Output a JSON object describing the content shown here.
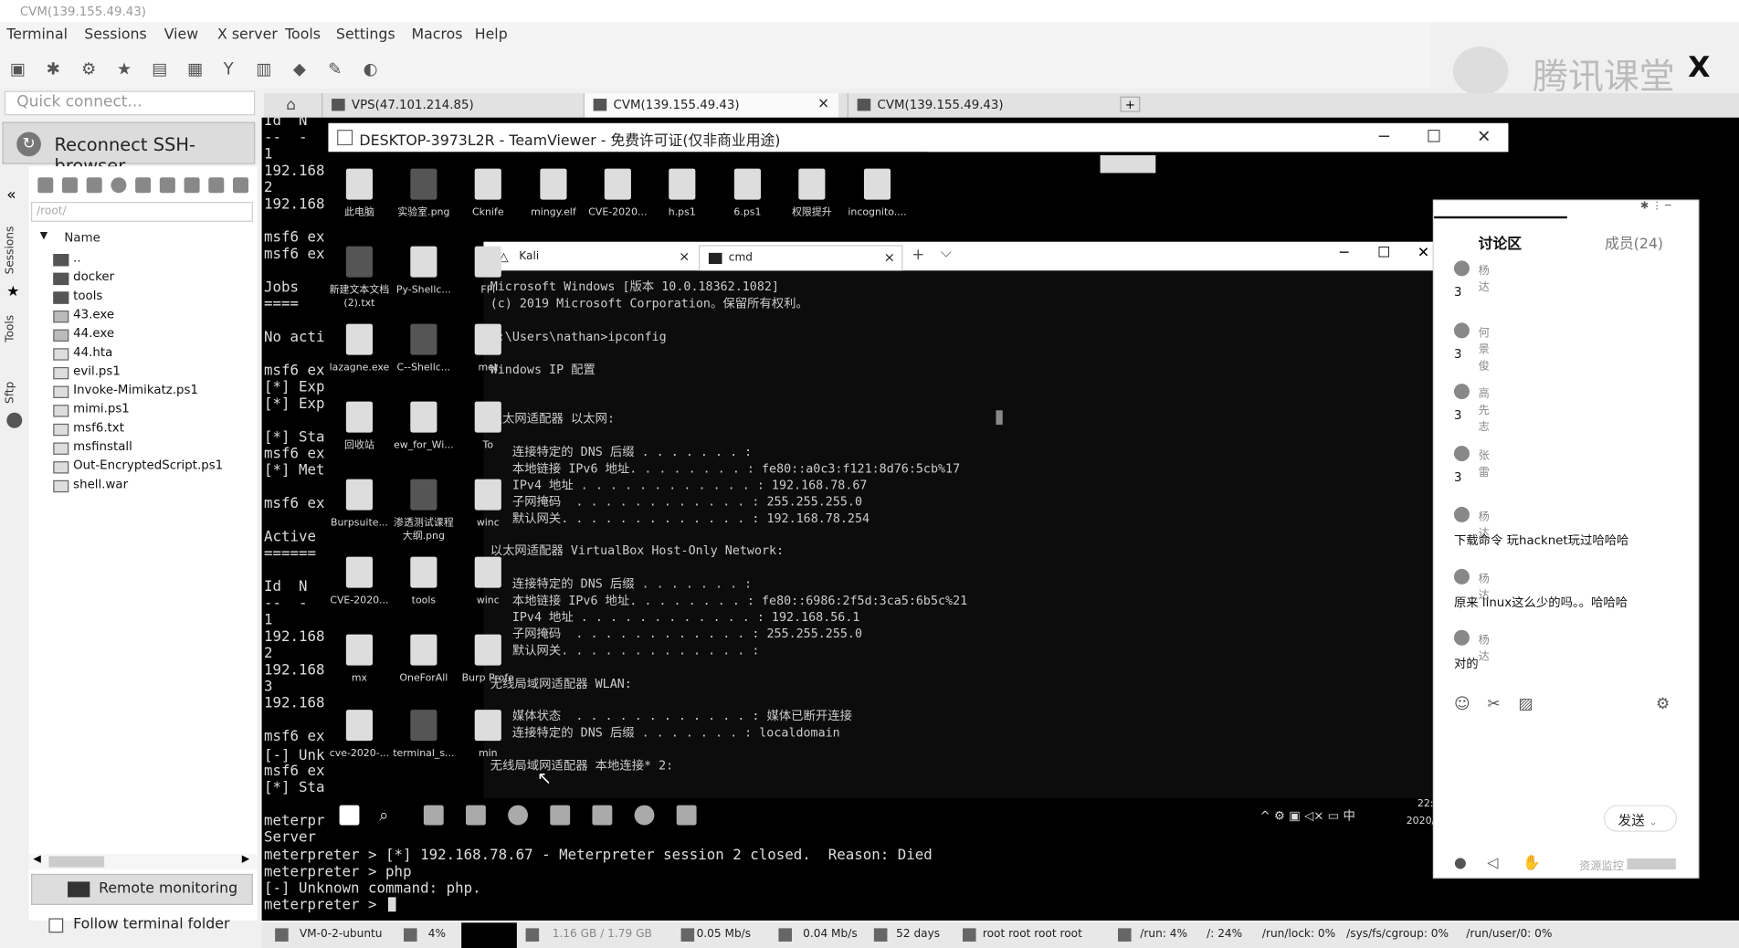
{
  "window": {
    "title": "CVM(139.155.49.43)"
  },
  "menu": [
    "Terminal",
    "Sessions",
    "View",
    "X server",
    "Tools",
    "Settings",
    "Macros",
    "Help"
  ],
  "brand": {
    "text": "腾讯课堂",
    "close": "X"
  },
  "quick_connect": {
    "placeholder": "Quick connect..."
  },
  "session_tabs": [
    {
      "label": "VPS(47.101.214.85)"
    },
    {
      "label": "CVM(139.155.49.43)",
      "close": "×"
    },
    {
      "label": "CVM(139.155.49.43)"
    }
  ],
  "sidebar": {
    "reconnect_label": "Reconnect SSH-browser",
    "vertical_tabs": [
      "Sessions",
      "Tools",
      "Sftp"
    ],
    "path": "/root/",
    "name_header": "Name",
    "files": [
      {
        "name": "..",
        "type": "folder"
      },
      {
        "name": "docker",
        "type": "folder"
      },
      {
        "name": "tools",
        "type": "folder"
      },
      {
        "name": "43.exe",
        "type": "exe"
      },
      {
        "name": "44.exe",
        "type": "exe"
      },
      {
        "name": "44.hta",
        "type": "file"
      },
      {
        "name": "evil.ps1",
        "type": "file"
      },
      {
        "name": "Invoke-Mimikatz.ps1",
        "type": "file"
      },
      {
        "name": "mimi.ps1",
        "type": "file"
      },
      {
        "name": "msf6.txt",
        "type": "file"
      },
      {
        "name": "msfinstall",
        "type": "file"
      },
      {
        "name": "Out-EncryptedScript.ps1",
        "type": "file"
      },
      {
        "name": "shell.war",
        "type": "file"
      }
    ],
    "remote_monitoring": "Remote monitoring",
    "follow_folder": "Follow terminal folder"
  },
  "terminal_lines": [
    "Id  N",
    "--  -",
    "1",
    "192.168",
    "2",
    "192.168",
    "",
    "msf6 ex",
    "msf6 ex",
    "",
    "Jobs",
    "====",
    "",
    "No acti",
    "",
    "msf6 ex",
    "[*] Exp",
    "[*] Exp",
    "",
    "[*] Sta",
    "msf6 ex",
    "[*] Met",
    "",
    "msf6 ex",
    "",
    "Active",
    "======",
    "",
    "Id  N",
    "--  -",
    "1",
    "192.168",
    "2",
    "192.168",
    "3",
    "192.168",
    "",
    "msf6 ex",
    "[-] Unk",
    "msf6 ex",
    "[*] Sta",
    "",
    "meterpr",
    "Server",
    "meterpreter > [*] 192.168.78.67 - Meterpreter session 2 closed.  Reason: Died",
    "meterpreter > php",
    "[-] Unknown command: php.",
    "meterpreter > "
  ],
  "teamviewer": {
    "title": "DESKTOP-3973L2R - TeamViewer - 免费许可证(仅非商业用途)",
    "min": "─",
    "max": "☐",
    "close": "✕"
  },
  "desktop_icons": [
    {
      "label": "此电脑"
    },
    {
      "label": "实验室.png"
    },
    {
      "label": "Cknife"
    },
    {
      "label": "mingy.elf"
    },
    {
      "label": "CVE-2020..."
    },
    {
      "label": "h.ps1"
    },
    {
      "label": "6.ps1"
    },
    {
      "label": "权限提升"
    },
    {
      "label": "incognito...."
    },
    {
      "label": "新建文本文档 (2).txt"
    },
    {
      "label": "Py-Shellc..."
    },
    {
      "label": "FPi"
    },
    {
      "label": "lazagne.exe"
    },
    {
      "label": "C--Shellc..."
    },
    {
      "label": "met"
    },
    {
      "label": "回收站"
    },
    {
      "label": "ew_for_Wi..."
    },
    {
      "label": "To"
    },
    {
      "label": "Burpsuite..."
    },
    {
      "label": "渗透测试课程大纲.png"
    },
    {
      "label": "winc"
    },
    {
      "label": "CVE-2020..."
    },
    {
      "label": "tools"
    },
    {
      "label": "winc"
    },
    {
      "label": "mx"
    },
    {
      "label": "OneForAll"
    },
    {
      "label": "Burp Profe"
    },
    {
      "label": "cve-2020-..."
    },
    {
      "label": "terminal_s..."
    },
    {
      "label": "min"
    }
  ],
  "cmd": {
    "tabs": [
      {
        "label": "Kali",
        "close": "×"
      },
      {
        "label": "cmd",
        "close": "×"
      }
    ],
    "new_tab": "+",
    "dropdown": "⌵",
    "lines": [
      "Microsoft Windows [版本 10.0.18362.1082]",
      "(c) 2019 Microsoft Corporation。保留所有权利。",
      "",
      "C:\\Users\\nathan>ipconfig",
      "",
      "Windows IP 配置",
      "",
      "",
      "以太网适配器 以太网:",
      "",
      "   连接特定的 DNS 后缀 . . . . . . . :",
      "   本地链接 IPv6 地址. . . . . . . . : fe80::a0c3:f121:8d76:5cb%17",
      "   IPv4 地址 . . . . . . . . . . . . : 192.168.78.67",
      "   子网掩码  . . . . . . . . . . . . : 255.255.255.0",
      "   默认网关. . . . . . . . . . . . . : 192.168.78.254",
      "",
      "以太网适配器 VirtualBox Host-Only Network:",
      "",
      "   连接特定的 DNS 后缀 . . . . . . . :",
      "   本地链接 IPv6 地址. . . . . . . . : fe80::6986:2f5d:3ca5:6b5c%21",
      "   IPv4 地址 . . . . . . . . . . . . : 192.168.56.1",
      "   子网掩码  . . . . . . . . . . . . : 255.255.255.0",
      "   默认网关. . . . . . . . . . . . . :",
      "",
      "无线局域网适配器 WLAN:",
      "",
      "   媒体状态  . . . . . . . . . . . . : 媒体已断开连接",
      "   连接特定的 DNS 后缀 . . . . . . . : localdomain",
      "",
      "无线局域网适配器 本地连接* 2:"
    ]
  },
  "remote_taskbar": {
    "tray": "^ ⚙ ▣ ◁× ▭ 中",
    "time": "22:",
    "date": "2020/"
  },
  "discussion": {
    "tab_discussion": "讨论区",
    "tab_members": "成员(24)",
    "messages": [
      {
        "name": "杨达",
        "text": "3"
      },
      {
        "name": "何景俊",
        "text": "3"
      },
      {
        "name": "高先志",
        "text": "3"
      },
      {
        "name": "张雷",
        "text": "3"
      },
      {
        "name": "杨达",
        "text": "下载命令 玩hacknet玩过哈哈哈"
      },
      {
        "name": "杨达",
        "text": "原来 linux这么少的吗。。哈哈哈"
      },
      {
        "name": "杨达",
        "text": "对的"
      }
    ],
    "send": "发送",
    "resource_monitor": "资源监控"
  },
  "statusbar": [
    {
      "label": "VM-0-2-ubuntu"
    },
    {
      "label": "4%"
    },
    {
      "label": "1.16 GB / 1.79 GB"
    },
    {
      "label": "0.05 Mb/s"
    },
    {
      "label": "0.04 Mb/s"
    },
    {
      "label": "52 days"
    },
    {
      "label": "root  root  root  root"
    },
    {
      "label": "/run: 4%"
    },
    {
      "label": "/: 24%"
    },
    {
      "label": "/run/lock: 0%"
    },
    {
      "label": "/sys/fs/cgroup: 0%"
    },
    {
      "label": "/run/user/0: 0%"
    }
  ]
}
